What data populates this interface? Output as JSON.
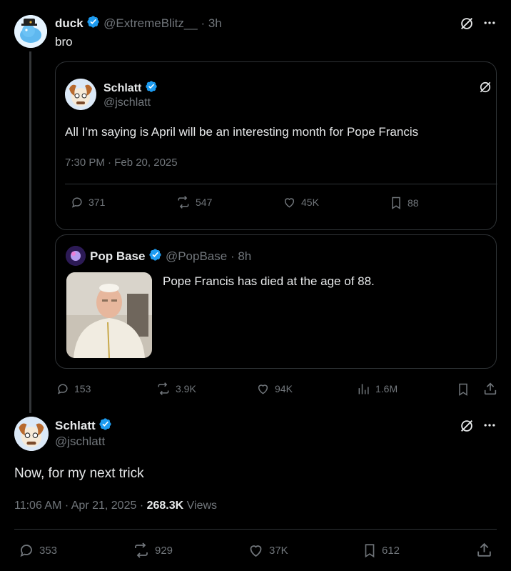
{
  "reply_tweet": {
    "name": "duck",
    "handle": "@ExtremeBlitz__",
    "time": "· 3h",
    "text": "bro"
  },
  "quoted_schlatt": {
    "name": "Schlatt",
    "handle": "@jschlatt",
    "text": "All I’m saying is April will be an interesting month for Pope Francis",
    "timestamp": "7:30 PM · Feb 20, 2025",
    "replies": "371",
    "reposts": "547",
    "likes": "45K",
    "bookmarks": "88"
  },
  "quoted_popbase": {
    "name": "Pop Base",
    "handle": "@PopBase",
    "time": "· 8h",
    "text": "Pope Francis has died at the age of 88."
  },
  "reply_actions": {
    "replies": "153",
    "reposts": "3.9K",
    "likes": "94K",
    "views": "1.6M"
  },
  "main_tweet": {
    "name": "Schlatt",
    "handle": "@jschlatt",
    "text": "Now, for my next trick",
    "timestamp": "11:06 AM · Apr 21, 2025 · ",
    "views_count": "268.3K",
    "views_label": " Views",
    "replies": "353",
    "reposts": "929",
    "likes": "37K",
    "bookmarks": "612"
  },
  "colors": {
    "background": "#000000",
    "text": "#e7e9ea",
    "muted": "#71767b",
    "border": "#2f3336",
    "verified": "#1d9bf0"
  }
}
